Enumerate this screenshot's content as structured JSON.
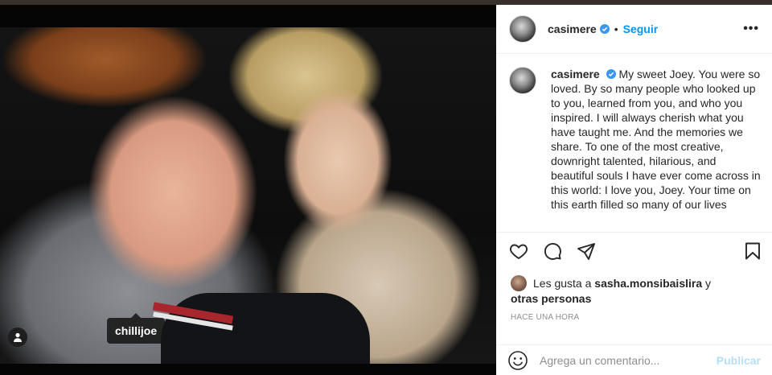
{
  "post": {
    "photo": {
      "tag_username": "chillijoe",
      "user_tag_icon": "user-silhouette-icon"
    },
    "header": {
      "username": "casimere",
      "verified_icon": "verified-badge-icon",
      "separator": "•",
      "follow_label": "Seguir",
      "more_label": "•••"
    },
    "caption": {
      "username": "casimere",
      "text": "My sweet Joey. You were so loved. By so many people who looked up to you, learned from you, and who you inspired. I will always cherish what you have taught me. And the memories we share. To one of the most creative, downright talented, hilarious, and beautiful souls I have ever come across in this world: I love you, Joey. Your time on this earth filled so many of our lives"
    },
    "actions": {
      "like_icon": "heart-icon",
      "comment_icon": "comment-icon",
      "share_icon": "paper-plane-icon",
      "save_icon": "bookmark-icon"
    },
    "likes": {
      "prefix": "Les gusta a",
      "user": "sasha.monsibaislira",
      "conjunction": "y",
      "others": "otras personas"
    },
    "timestamp": "HACE UNA HORA",
    "comment": {
      "placeholder": "Agrega un comentario...",
      "publish_label": "Publicar",
      "emoji_icon": "smiley-icon"
    }
  },
  "colors": {
    "accent": "#0095f6",
    "publish_disabled": "#b2dffc",
    "text": "#262626",
    "muted": "#8e8e8e"
  }
}
